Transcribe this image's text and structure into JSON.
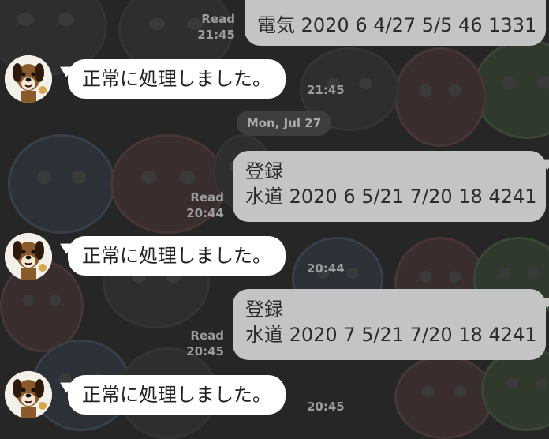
{
  "messages": [
    {
      "direction": "out",
      "line1": "",
      "line2": "電気 2020 6 4/27 5/5 46 1331",
      "read": "Read",
      "time": "21:45"
    },
    {
      "direction": "in",
      "text": "正常に処理しました。",
      "time": "21:45"
    },
    {
      "direction": "separator",
      "text": "Mon, Jul 27"
    },
    {
      "direction": "out",
      "line1": "登録",
      "line2": "水道 2020 6 5/21 7/20 18 4241",
      "read": "Read",
      "time": "20:44"
    },
    {
      "direction": "in",
      "text": "正常に処理しました。",
      "time": "20:44"
    },
    {
      "direction": "out",
      "line1": "登録",
      "line2": "水道 2020 7 5/21 7/20 18 4241",
      "read": "Read",
      "time": "20:45"
    },
    {
      "direction": "in",
      "text": "正常に処理しました。",
      "time": "20:45"
    }
  ],
  "colors": {
    "background": "#262626",
    "outgoing_bubble": "#c4c4c4",
    "incoming_bubble": "#ffffff",
    "meta_text": "#9c9c9c"
  },
  "icons": {
    "avatar": "dog-mascot-avatar"
  }
}
